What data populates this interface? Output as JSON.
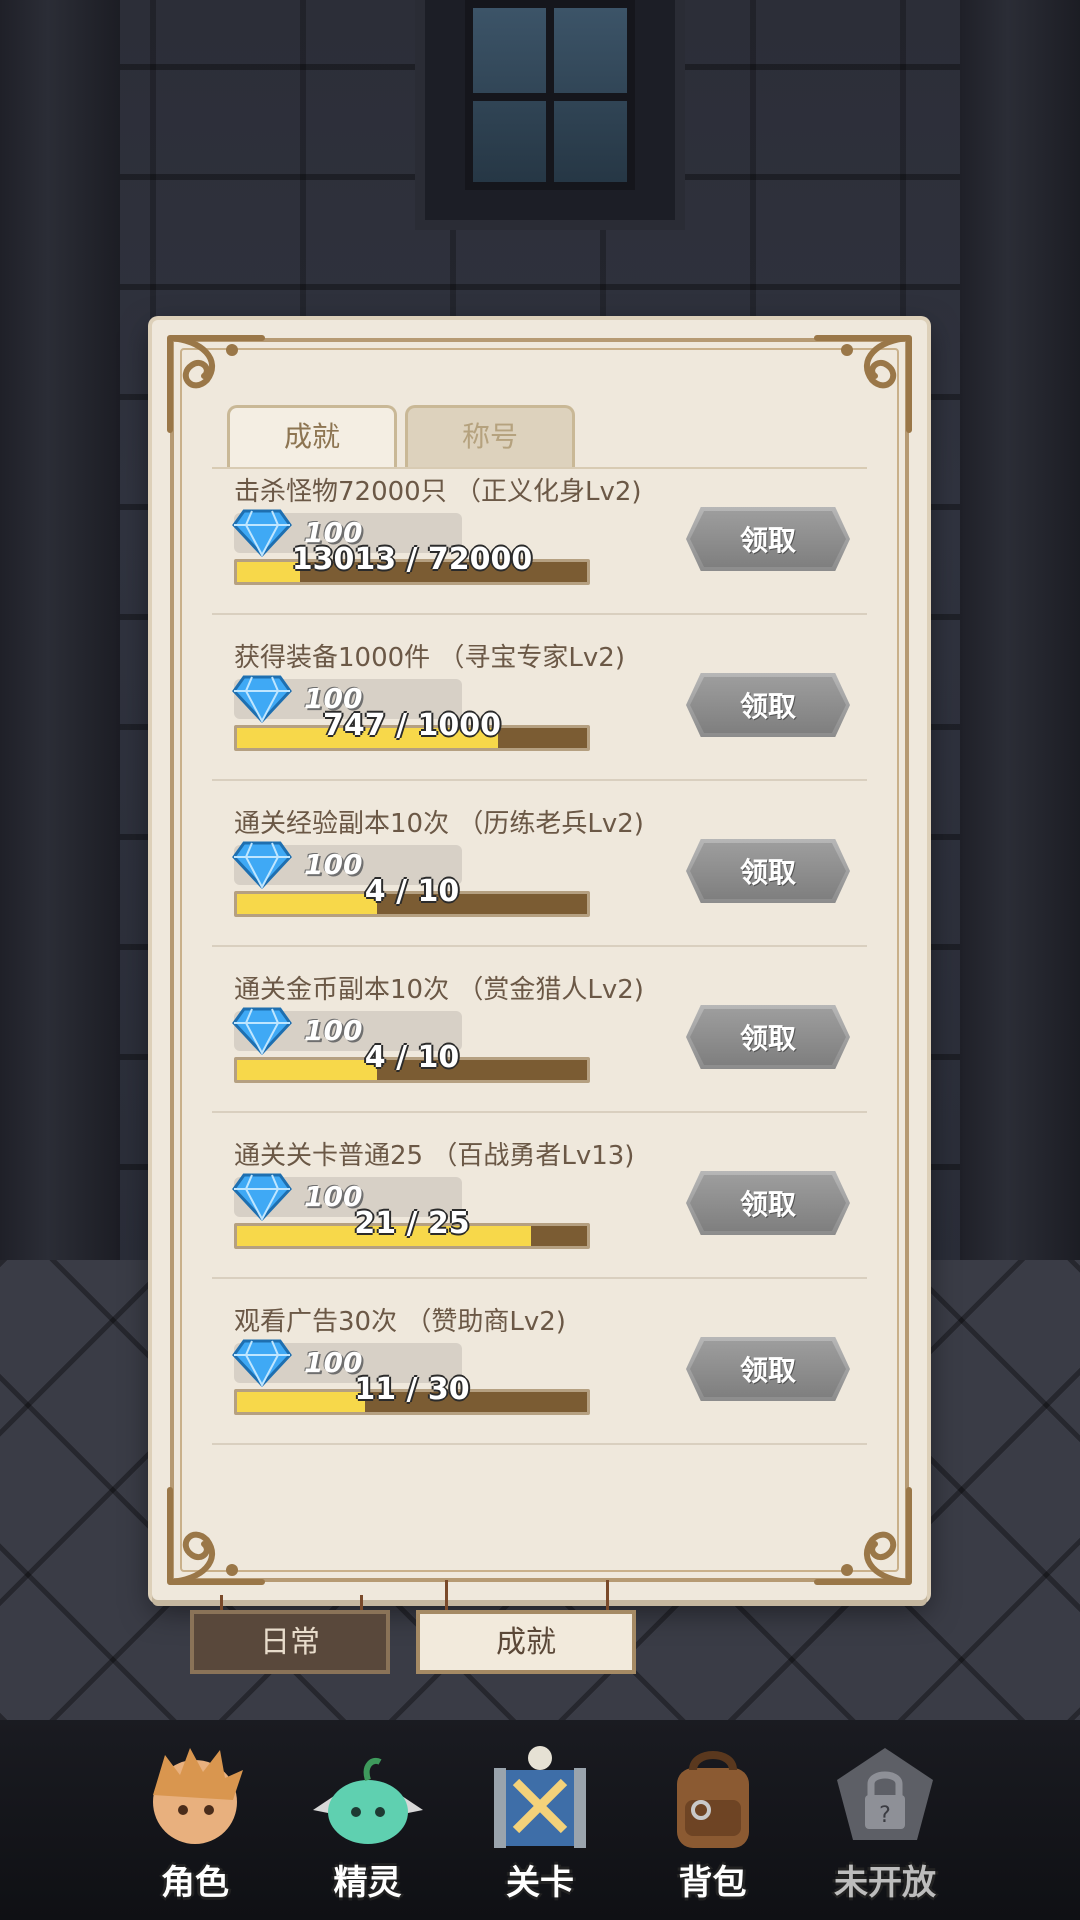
{
  "panel": {
    "tabs": [
      {
        "label": "成就",
        "active": true
      },
      {
        "label": "称号",
        "active": false
      }
    ],
    "achievements": [
      {
        "title": "击杀怪物72000只 （正义化身Lv2)",
        "reward": "100",
        "progress_text": "13013 / 72000",
        "progress": 0.181,
        "claim_label": "领取"
      },
      {
        "title": "获得装备1000件 （寻宝专家Lv2)",
        "reward": "100",
        "progress_text": "747 / 1000",
        "progress": 0.747,
        "claim_label": "领取"
      },
      {
        "title": "通关经验副本10次 （历练老兵Lv2)",
        "reward": "100",
        "progress_text": "4 / 10",
        "progress": 0.4,
        "claim_label": "领取"
      },
      {
        "title": "通关金币副本10次 （赏金猎人Lv2)",
        "reward": "100",
        "progress_text": "4 / 10",
        "progress": 0.4,
        "claim_label": "领取"
      },
      {
        "title": "通关关卡普通25 （百战勇者Lv13)",
        "reward": "100",
        "progress_text": "21 / 25",
        "progress": 0.84,
        "claim_label": "领取"
      },
      {
        "title": "观看广告30次 （赞助商Lv2)",
        "reward": "100",
        "progress_text": "11 / 30",
        "progress": 0.367,
        "claim_label": "领取"
      }
    ]
  },
  "quest_tabs": [
    {
      "label": "日常",
      "active": false
    },
    {
      "label": "成就",
      "active": true
    }
  ],
  "nav": [
    {
      "label": "角色",
      "icon": "hero-portrait-icon",
      "locked": false
    },
    {
      "label": "精灵",
      "icon": "slime-spirit-icon",
      "locked": false
    },
    {
      "label": "关卡",
      "icon": "crossed-swords-stage-icon",
      "locked": false
    },
    {
      "label": "背包",
      "icon": "backpack-icon",
      "locked": false
    },
    {
      "label": "未开放",
      "icon": "locked-padlock-icon",
      "locked": true
    }
  ],
  "colors": {
    "parchment": "#efe8dc",
    "progress_fill": "#f7d84a",
    "progress_track": "#7b5c33",
    "claim_button": "#9d9d9d",
    "gem": "#3fa9f5"
  }
}
